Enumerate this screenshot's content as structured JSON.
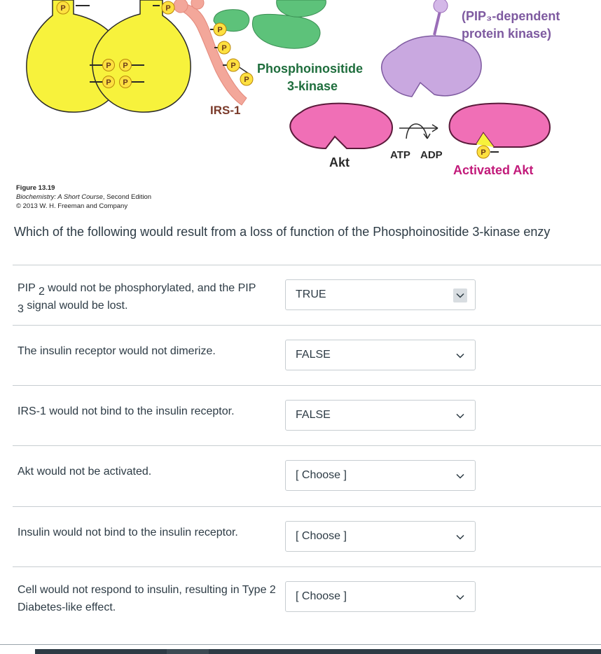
{
  "figure": {
    "labels": {
      "phosphate": "P",
      "irs1": "IRS-1",
      "pi3k_line1": "Phosphoinositide",
      "pi3k_line2": "3-kinase",
      "pdk_line1": "(PIP₃-dependent",
      "pdk_line2": "protein kinase)",
      "akt": "Akt",
      "atp": "ATP",
      "adp": "ADP",
      "activated_akt": "Activated Akt"
    },
    "caption": {
      "number": "Figure 13.19",
      "book": "Biochemistry: A Short Course",
      "edition": ", Second Edition",
      "copyright": "© 2013 W. H. Freeman and Company"
    }
  },
  "question": "Which of the following would result from a loss of function of the Phosphoinositide 3-kinase enzy",
  "rows": [
    {
      "text_a": "PIP ",
      "sub_a": "2",
      "text_b": " would not be phosphorylated, and the PIP",
      "sub_b": "3",
      "text_c": " signal would be lost.",
      "answer": "TRUE"
    },
    {
      "text": "The insulin receptor would not dimerize.",
      "answer": "FALSE"
    },
    {
      "text": "IRS-1 would not bind to the insulin receptor.",
      "answer": "FALSE"
    },
    {
      "text": "Akt would not be activated.",
      "answer": "[ Choose ]"
    },
    {
      "text": "Insulin would not bind to the insulin receptor.",
      "answer": "[ Choose ]"
    },
    {
      "text": "Cell would not respond to insulin, resulting in Type 2 Diabetes-like effect.",
      "answer": "[ Choose ]"
    }
  ],
  "icons": {
    "dropdown": "chevron-down-icon"
  }
}
